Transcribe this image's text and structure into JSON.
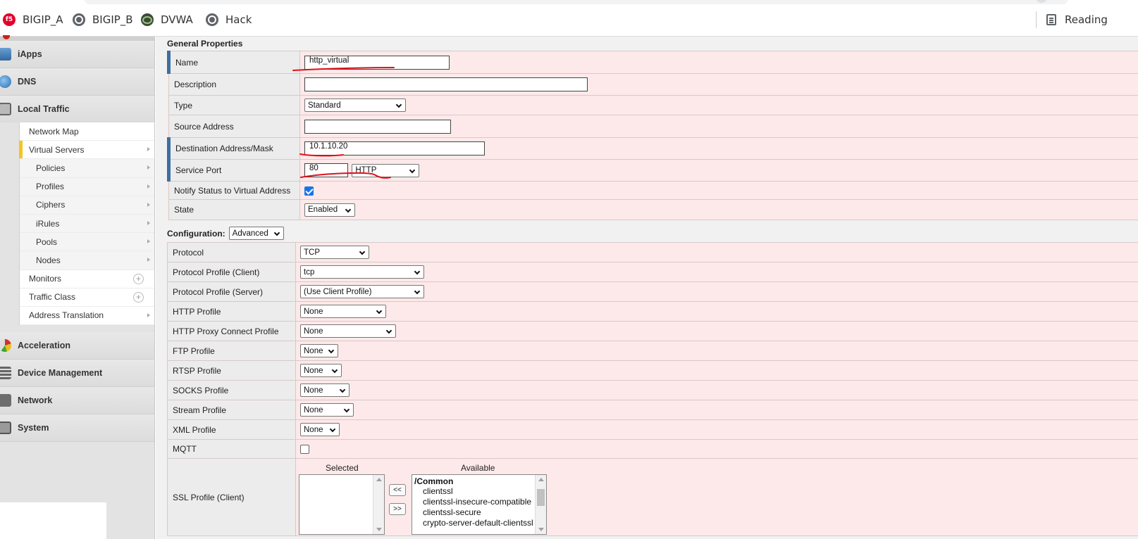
{
  "bookmarks": [
    {
      "label": "BIGIP_A",
      "icon": "f5-icon"
    },
    {
      "label": "BIGIP_B",
      "icon": "globe-icon"
    },
    {
      "label": "DVWA",
      "icon": "dvwa-icon"
    },
    {
      "label": "Hack",
      "icon": "globe-icon"
    }
  ],
  "f5_logo_text": "f5",
  "reading_list": "Reading",
  "sidebar": {
    "sections_top": [
      {
        "label": "iApps",
        "icon": "iapps-icon"
      },
      {
        "label": "DNS",
        "icon": "dns-icon"
      },
      {
        "label": "Local Traffic",
        "icon": "local-traffic-icon"
      }
    ],
    "local_traffic_items": [
      {
        "label": "Network Map"
      },
      {
        "label": "Virtual Servers"
      },
      {
        "label": "Policies"
      },
      {
        "label": "Profiles"
      },
      {
        "label": "Ciphers"
      },
      {
        "label": "iRules"
      },
      {
        "label": "Pools"
      },
      {
        "label": "Nodes"
      },
      {
        "label": "Monitors",
        "plus": "+"
      },
      {
        "label": "Traffic Class",
        "plus": "+"
      },
      {
        "label": "Address Translation"
      }
    ],
    "sections_bottom": [
      {
        "label": "Acceleration",
        "icon": "acceleration-icon"
      },
      {
        "label": "Device Management",
        "icon": "device-management-icon"
      },
      {
        "label": "Network",
        "icon": "network-icon"
      },
      {
        "label": "System",
        "icon": "system-icon"
      }
    ]
  },
  "general": {
    "title": "General Properties",
    "name_label": "Name",
    "name_value": "http_virtual",
    "description_label": "Description",
    "description_value": "",
    "type_label": "Type",
    "type_value": "Standard",
    "source_label": "Source Address",
    "source_value": "",
    "dest_label": "Destination Address/Mask",
    "dest_value": "10.1.10.20",
    "port_label": "Service Port",
    "port_value": "80",
    "port_protocol": "HTTP",
    "notify_label": "Notify Status to Virtual Address",
    "notify_checked": true,
    "state_label": "State",
    "state_value": "Enabled"
  },
  "configuration": {
    "label": "Configuration:",
    "mode": "Advanced",
    "rows": [
      {
        "label": "Protocol",
        "value": "TCP"
      },
      {
        "label": "Protocol Profile (Client)",
        "value": "tcp"
      },
      {
        "label": "Protocol Profile (Server)",
        "value": "(Use Client Profile)"
      },
      {
        "label": "HTTP Profile",
        "value": "None"
      },
      {
        "label": "HTTP Proxy Connect Profile",
        "value": "None"
      },
      {
        "label": "FTP Profile",
        "value": "None"
      },
      {
        "label": "RTSP Profile",
        "value": "None"
      },
      {
        "label": "SOCKS Profile",
        "value": "None"
      },
      {
        "label": "Stream Profile",
        "value": "None"
      },
      {
        "label": "XML Profile",
        "value": "None"
      }
    ],
    "mqtt_label": "MQTT",
    "mqtt_checked": false,
    "ssl_client_label": "SSL Profile (Client)",
    "selected_header": "Selected",
    "available_header": "Available",
    "move_left": "<<",
    "move_right": ">>",
    "available_group": "/Common",
    "available_items": [
      "clientssl",
      "clientssl-insecure-compatible",
      "clientssl-secure",
      "crypto-server-default-clientssl"
    ]
  },
  "colors": {
    "row_pink": "#fde9e9",
    "label_grey": "#ececec",
    "required_bar": "#3f6ea3",
    "active_yellow": "#f6c51b",
    "annotation_red": "#e0101a"
  }
}
